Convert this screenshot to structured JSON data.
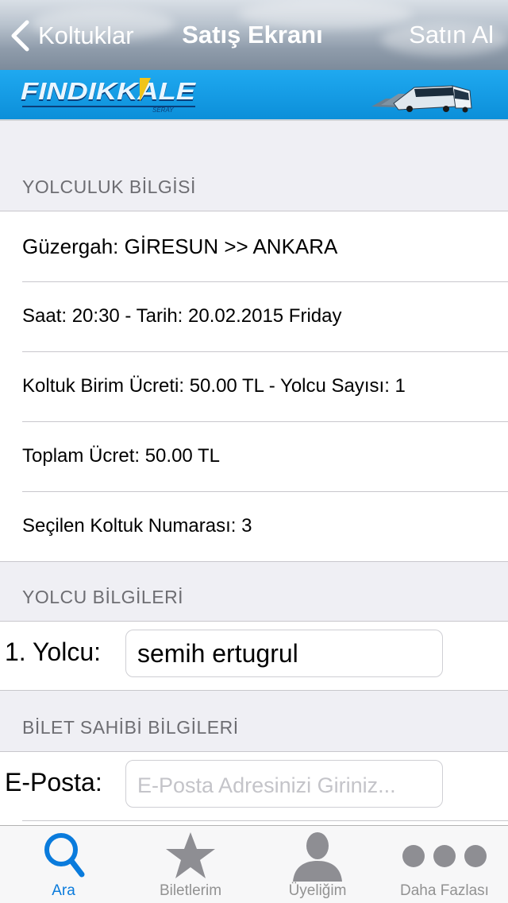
{
  "nav": {
    "back_label": "Koltuklar",
    "title": "Satış Ekranı",
    "action_label": "Satın Al"
  },
  "brand": {
    "logo_text": "FINDIKKALE",
    "logo_subtext": "SERAY"
  },
  "trip": {
    "header": "YOLCULUK BİLGİSİ",
    "rows": [
      "Güzergah: GİRESUN >> ANKARA",
      "Saat: 20:30  - Tarih: 20.02.2015 Friday",
      "Koltuk Birim Ücreti: 50.00 TL - Yolcu Sayısı: 1",
      "Toplam Ücret: 50.00 TL",
      "Seçilen Koltuk Numarası: 3"
    ]
  },
  "passenger": {
    "header": "YOLCU BİLGİLERİ",
    "label": "1. Yolcu:",
    "value": "semih ertugrul"
  },
  "owner": {
    "header": "BİLET SAHİBİ BİLGİLERİ",
    "email_label": "E-Posta:",
    "email_value": "",
    "email_placeholder": "E-Posta Adresinizi Giriniz..."
  },
  "tabs": [
    {
      "label": "Ara",
      "icon": "search-icon",
      "active": true
    },
    {
      "label": "Biletlerim",
      "icon": "star-icon",
      "active": false
    },
    {
      "label": "Üyeliğim",
      "icon": "person-icon",
      "active": false
    },
    {
      "label": "Daha Fazlası",
      "icon": "more-icon",
      "active": false
    }
  ],
  "colors": {
    "accent": "#0a7bdc",
    "banner": "#0c8fd9",
    "inactive_tab": "#929292"
  }
}
